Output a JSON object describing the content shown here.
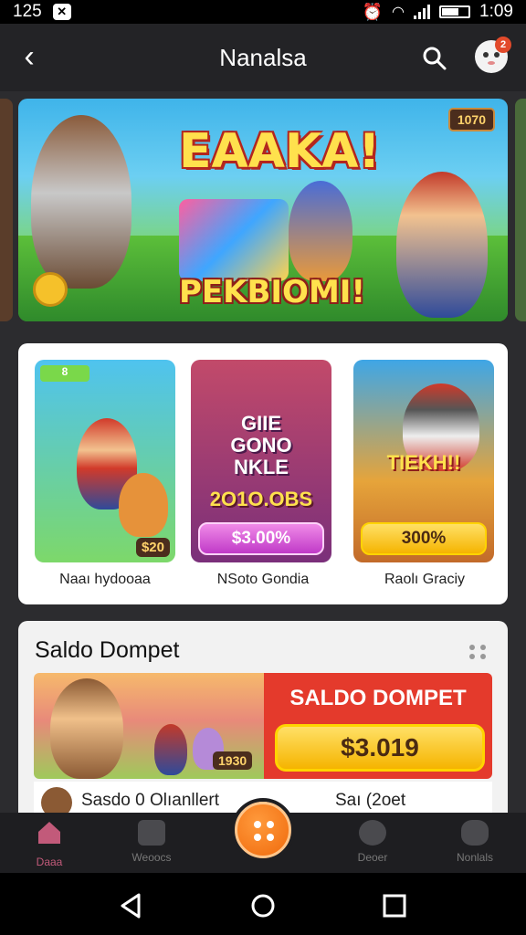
{
  "status_bar": {
    "time_left": "125",
    "time_right": "1:09"
  },
  "header": {
    "title": "Nanalsa",
    "notification_count": "2"
  },
  "banner": {
    "title": "EAAKA!",
    "subtitle": "PEKBIOMI!",
    "badge": "1070"
  },
  "games": [
    {
      "label": "Naaı hydooaa",
      "badge": "$20",
      "tile_text": "",
      "button": ""
    },
    {
      "label": "NSoto Gondia",
      "badge": "",
      "tile_text": "GIIE\nGONO\nNKLE",
      "amount": "2O1O.OBS",
      "button": "$3.00%"
    },
    {
      "label": "Raolı Graciy",
      "badge": "",
      "tile_text": "TIEKH!!",
      "button": "300%"
    }
  ],
  "games_corner_tag": "8",
  "wallet": {
    "title": "Saldo Dompet",
    "promo_title": "SALDO DOMPET",
    "promo_amount": "$3.019",
    "art_badge": "1930",
    "row_left": "Sasdo 0 Olıanllert",
    "row_right": "Saı (2oet"
  },
  "tabs": [
    {
      "label": "Daaa",
      "active": true
    },
    {
      "label": "Weoocs",
      "active": false
    },
    {
      "label": "Deoer",
      "active": false
    },
    {
      "label": "Nonlals",
      "active": false
    }
  ],
  "colors": {
    "accent": "#f06a0c",
    "promo_red": "#e43a2c",
    "active_tab": "#c25a7a"
  }
}
